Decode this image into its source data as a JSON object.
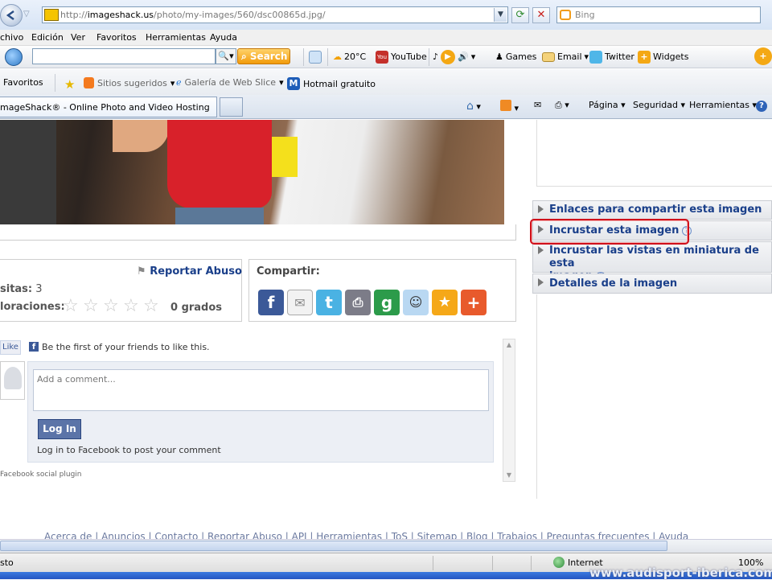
{
  "address_bar": {
    "url_prefix": "http://",
    "url_domain": "imageshack.us",
    "url_path": "/photo/my-images/560/dsc00865d.jpg/",
    "search_placeholder": "Bing"
  },
  "menu_bar": [
    "chivo",
    "Edición",
    "Ver",
    "Favoritos",
    "Herramientas",
    "Ayuda"
  ],
  "toolbar": {
    "search_button": "Search",
    "weather": "20°C",
    "youtube": "YouTube",
    "games": "Games",
    "email": "Email",
    "twitter": "Twitter",
    "widgets": "Widgets"
  },
  "favorites_bar": {
    "favorites": "Favoritos",
    "suggested": "Sitios sugeridos",
    "webslice": "Galería de Web Slice",
    "hotmail": "Hotmail gratuito"
  },
  "tab": {
    "title": "mageShack® - Online Photo and Video Hosting"
  },
  "command_bar": {
    "page": "Página",
    "security": "Seguridad",
    "tools": "Herramientas"
  },
  "right_panel": {
    "share_links": "Enlaces para compartir esta imagen",
    "embed": "Incrustar esta imagen",
    "embed_thumbs_line1": "Incrustar las vistas en miniatura de esta",
    "embed_thumbs_line2": "imagen",
    "details": "Detalles de la imagen"
  },
  "stats": {
    "report": "Reportar Abuso",
    "visits_label": "sitas:",
    "visits_value": "3",
    "ratings_label": "loraciones:",
    "rating_value": 0,
    "rating_text": "0 grados"
  },
  "share": {
    "title": "Compartir:"
  },
  "facebook": {
    "like": "Like",
    "first_friend": "Be the first of your friends to like this.",
    "comment_placeholder": "Add a comment...",
    "login": "Log In",
    "login_hint": "Log in to Facebook to post your comment",
    "plugin": "Facebook social plugin"
  },
  "footer": {
    "links": [
      "Acerca de",
      "Anuncios",
      "Contacto",
      "Reportar Abuso",
      "API",
      "Herramientas",
      "ToS",
      "Sitemap",
      "Blog",
      "Trabajos",
      "Preguntas frecuentes",
      "Ayuda"
    ]
  },
  "status_bar": {
    "left": "sto",
    "zone": "Internet",
    "zoom": "100%"
  },
  "watermark": "www.audisport-iberica.com"
}
